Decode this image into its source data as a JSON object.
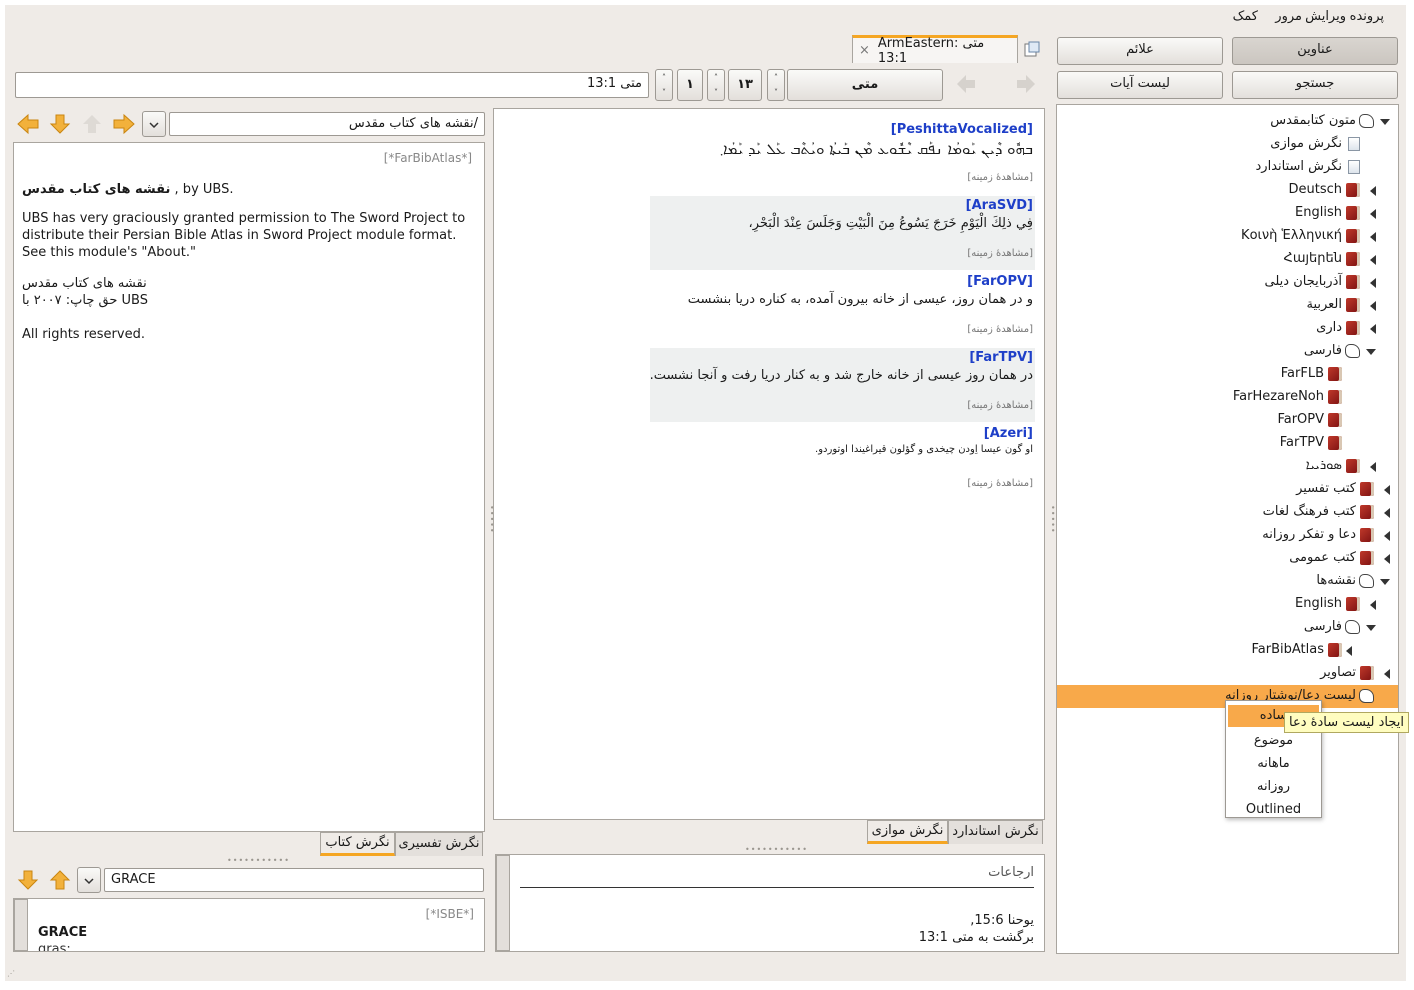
{
  "menu": {
    "file": "پرونده",
    "edit": "ویرایش",
    "view": "مرور",
    "help": "کمک"
  },
  "sidebar_buttons": {
    "titles": "عناوین",
    "bookmarks": "علائم",
    "search": "جستجو",
    "verse_list": "لیست آیات"
  },
  "tab": {
    "label": "ArmEastern: متی 13:1",
    "close": "×"
  },
  "nav": {
    "reference": "متی 13:1",
    "book": "متی",
    "chapter": "۱۳",
    "verse": "۱",
    "up": "˄",
    "down": "˅"
  },
  "text_modules": [
    {
      "name": "[PeshittaVocalized]",
      "text": "ܒܗܽܘ ܕܶܝܢ ܝܰܘܡܳܐ ܢܦܰܩ ܝܶܫܽܘܥ ܡܶܢ ܒܰܝܬܳܐ ܘܝܳܬܶܒ ܥܰܠ ܝܰܕ ܝܰܡܳܐ܂",
      "context": "[مشاهدهٔ زمینه]",
      "shaded": false
    },
    {
      "name": "[AraSVD]",
      "text": "فِي ذلِكَ الْيَوْمِ خَرَجَ يَسُوعُ مِنَ الْبَيْتِ وَجَلَسَ عِنْدَ الْبَحْرِ،",
      "context": "[مشاهدهٔ زمینه]",
      "shaded": true
    },
    {
      "name": "[FarOPV]",
      "text": "و در همان روز، عیسی از خانه بیرون آمده، به کناره دریا بنشست",
      "context": "[مشاهدهٔ زمینه]",
      "shaded": false
    },
    {
      "name": "[FarTPV]",
      "text": "در همان روز عیسی از خانه خارج شد و به کنار دریا رفت و آنجا نشست.",
      "context": "[مشاهدهٔ زمینه]",
      "shaded": true
    },
    {
      "name": "[Azeri]",
      "text": "او گون عیسا اِودن چیخدی و گؤلون قیراغیندا اوتوردو.",
      "context": "[مشاهدهٔ زمینه]",
      "shaded": false
    }
  ],
  "middle_tabs": {
    "standard": "نگرش استاندارد",
    "parallel": "نگرش موازی"
  },
  "references": {
    "title": "ارجاعات",
    "line1": "یوحنا 15:6,",
    "line2": "برگشت به متی 13:1"
  },
  "book_panel": {
    "path": "/نقشه های کتاب مقدس",
    "module": "[*FarBibAtlas*]",
    "heading_bold": "نقشه های کتاب مقدس",
    "heading_rest": ", by UBS.",
    "para1": "UBS has very graciously granted permission to The Sword Project to distribute their Persian Bible Atlas in Sword Project module format. See this module's \"About.\"",
    "line_title": "نقشه های کتاب مقدس",
    "line_copy": "UBS حق چاپ: ۲۰۰۷ با",
    "rights": "All rights reserved."
  },
  "left_tabs": {
    "commentary": "نگرش تفسیری",
    "book": "نگرش کتاب"
  },
  "dict": {
    "search": "GRACE",
    "module": "[*ISBE*]",
    "word": "GRACE",
    "next": "gras;"
  },
  "tree": [
    {
      "label": "متون کتابمقدس",
      "icon": "hand",
      "exp": "down",
      "indent": 0
    },
    {
      "label": "نگرش موازی",
      "icon": "doc",
      "exp": "none",
      "indent": 1
    },
    {
      "label": "نگرش استاندارد",
      "icon": "doc",
      "exp": "none",
      "indent": 1
    },
    {
      "label": "Deutsch",
      "icon": "book",
      "exp": "left",
      "indent": 1
    },
    {
      "label": "English",
      "icon": "book",
      "exp": "left",
      "indent": 1
    },
    {
      "label": "Κοινὴ Ἑλληνική",
      "icon": "book",
      "exp": "left",
      "indent": 1
    },
    {
      "label": "Հայերեն",
      "icon": "book",
      "exp": "left",
      "indent": 1
    },
    {
      "label": "آذربایجان دیلی",
      "icon": "book",
      "exp": "left",
      "indent": 1
    },
    {
      "label": "العربية",
      "icon": "book",
      "exp": "left",
      "indent": 1
    },
    {
      "label": "داری",
      "icon": "book",
      "exp": "left",
      "indent": 1
    },
    {
      "label": "فارسی",
      "icon": "hand",
      "exp": "down",
      "indent": 1
    },
    {
      "label": "FarFLB",
      "icon": "book",
      "exp": "none",
      "indent": 2
    },
    {
      "label": "FarHezareNoh",
      "icon": "book",
      "exp": "none",
      "indent": 2
    },
    {
      "label": "FarOPV",
      "icon": "book",
      "exp": "none",
      "indent": 2
    },
    {
      "label": "FarTPV",
      "icon": "book",
      "exp": "none",
      "indent": 2
    },
    {
      "label": "ܣܘܪܝܝܐ",
      "icon": "book",
      "exp": "left",
      "indent": 1
    },
    {
      "label": "کتب تفسیر",
      "icon": "book",
      "exp": "left",
      "indent": 0
    },
    {
      "label": "کتب فرهنگ لغات",
      "icon": "book",
      "exp": "left",
      "indent": 0
    },
    {
      "label": "دعا و تفکر روزانه",
      "icon": "book",
      "exp": "left",
      "indent": 0
    },
    {
      "label": "کتب عمومی",
      "icon": "book",
      "exp": "left",
      "indent": 0
    },
    {
      "label": "نقشه‌ها",
      "icon": "hand",
      "exp": "down",
      "indent": 0
    },
    {
      "label": "English",
      "icon": "book",
      "exp": "left",
      "indent": 1
    },
    {
      "label": "فارسی",
      "icon": "hand",
      "exp": "down",
      "indent": 1
    },
    {
      "label": "FarBibAtlas",
      "icon": "book",
      "exp": "left",
      "indent": 2
    },
    {
      "label": "تصاویر",
      "icon": "book",
      "exp": "left",
      "indent": 0
    },
    {
      "label": "لیست دعا/نوشتار روزانه",
      "icon": "hand",
      "exp": "none",
      "indent": 0,
      "selected": true
    }
  ],
  "context_menu": [
    "ساده",
    "موضوع",
    "ماهانه",
    "روزانه",
    "Outlined"
  ],
  "tooltip": "ایجاد لیست سادهٔ دعا",
  "colors": {
    "accent": "#f5a623",
    "selection": "#f8a94a",
    "link": "#1e3fc8"
  }
}
